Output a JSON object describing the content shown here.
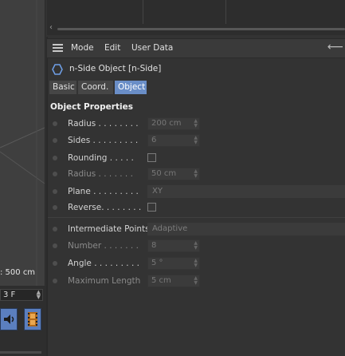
{
  "viewport": {
    "scale_label": ": 500 cm"
  },
  "timeline": {
    "frame_value": "3 F"
  },
  "menubar": {
    "items": [
      "Mode",
      "Edit",
      "User Data"
    ]
  },
  "object": {
    "title": "n-Side Object [n-Side]"
  },
  "tabs": [
    "Basic",
    "Coord.",
    "Object"
  ],
  "active_tab": "Object",
  "section": {
    "title": "Object Properties"
  },
  "properties": {
    "radius": {
      "label": "Radius . . . . . . . .",
      "value": "200 cm"
    },
    "sides": {
      "label": "Sides . . . . . . . . .",
      "value": "6"
    },
    "rounding": {
      "label": "Rounding . . . . ."
    },
    "round_radius": {
      "label": "Radius . . . . . . .",
      "value": "50 cm"
    },
    "plane": {
      "label": "Plane . . . . . . . . .",
      "value": "XY"
    },
    "reverse": {
      "label": "Reverse. . . . . . . ."
    },
    "intermediate_points": {
      "label": "Intermediate Points",
      "value": "Adaptive"
    },
    "number": {
      "label": "Number . . . . . . .",
      "value": "8"
    },
    "angle": {
      "label": "Angle . . . . . . . . .",
      "value": "5 °"
    },
    "max_length": {
      "label": "Maximum Length",
      "value": "5 cm"
    }
  },
  "colors": {
    "accent": "#6a8ec7",
    "background": "#333333"
  }
}
